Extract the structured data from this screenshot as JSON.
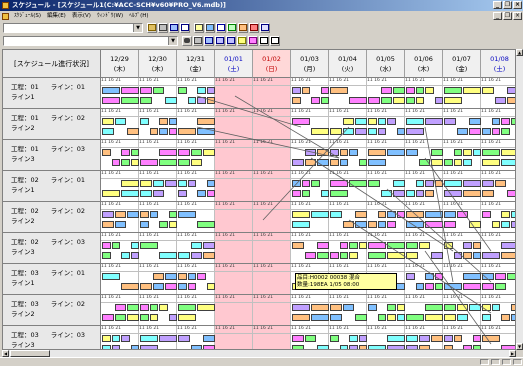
{
  "window": {
    "title": "スケジュール - [スケジュール1(C:¥ACC-SCH¥v60¥PRO_V6.mdb)]",
    "controls": {
      "minimize": "_",
      "restore": "❐",
      "close": "×"
    }
  },
  "menu": {
    "items": [
      "ｽｹｼﾞｭｰﾙ(S)",
      "編集(E)",
      "表示(V)",
      "ｳｨﾝﾄﾞｳ(W)",
      "ﾍﾙﾌﾟ(H)"
    ]
  },
  "toolbar": {
    "combo1_value": "",
    "combo2_value": ""
  },
  "schedule": {
    "corner_label": "[スケジュール進行状況]",
    "dates": [
      {
        "date": "12/29",
        "dow": "(木)",
        "kind": "normal"
      },
      {
        "date": "12/30",
        "dow": "(木)",
        "kind": "normal"
      },
      {
        "date": "12/31",
        "dow": "(金)",
        "kind": "normal"
      },
      {
        "date": "01/01",
        "dow": "(土)",
        "kind": "sat"
      },
      {
        "date": "01/02",
        "dow": "(日)",
        "kind": "sun"
      },
      {
        "date": "01/03",
        "dow": "(月)",
        "kind": "normal"
      },
      {
        "date": "01/04",
        "dow": "(火)",
        "kind": "normal"
      },
      {
        "date": "01/05",
        "dow": "(水)",
        "kind": "normal"
      },
      {
        "date": "01/06",
        "dow": "(木)",
        "kind": "normal"
      },
      {
        "date": "01/07",
        "dow": "(金)",
        "kind": "normal"
      },
      {
        "date": "01/08",
        "dow": "(土)",
        "kind": "sat"
      }
    ],
    "tick_text": "11 16 21",
    "rows": [
      {
        "process": "工程：01",
        "line_label": "ライン：01",
        "sub": "ライン1"
      },
      {
        "process": "工程：01",
        "line_label": "ライン：02",
        "sub": "ライン2"
      },
      {
        "process": "工程：01",
        "line_label": "ライン：03",
        "sub": "ライン3"
      },
      {
        "process": "工程：02",
        "line_label": "ライン：01",
        "sub": "ライン1"
      },
      {
        "process": "工程：02",
        "line_label": "ライン：02",
        "sub": "ライン2"
      },
      {
        "process": "工程：02",
        "line_label": "ライン：03",
        "sub": "ライン3"
      },
      {
        "process": "工程：03",
        "line_label": "ライン：01",
        "sub": "ライン1"
      },
      {
        "process": "工程：03",
        "line_label": "ライン：02",
        "sub": "ライン2"
      },
      {
        "process": "工程：03",
        "line_label": "ライン：03",
        "sub": "ライン3"
      }
    ],
    "tooltip": {
      "line1": "品目:H0002 00038 混合",
      "line2": "数量:198EA 1/05 08:00"
    }
  },
  "colors": {
    "holiday": "#ffc8d0",
    "job_palette": [
      "#80c0ff",
      "#ff80ff",
      "#80ff80",
      "#ffff80",
      "#80ffff",
      "#c0a0ff",
      "#ffc080"
    ]
  }
}
